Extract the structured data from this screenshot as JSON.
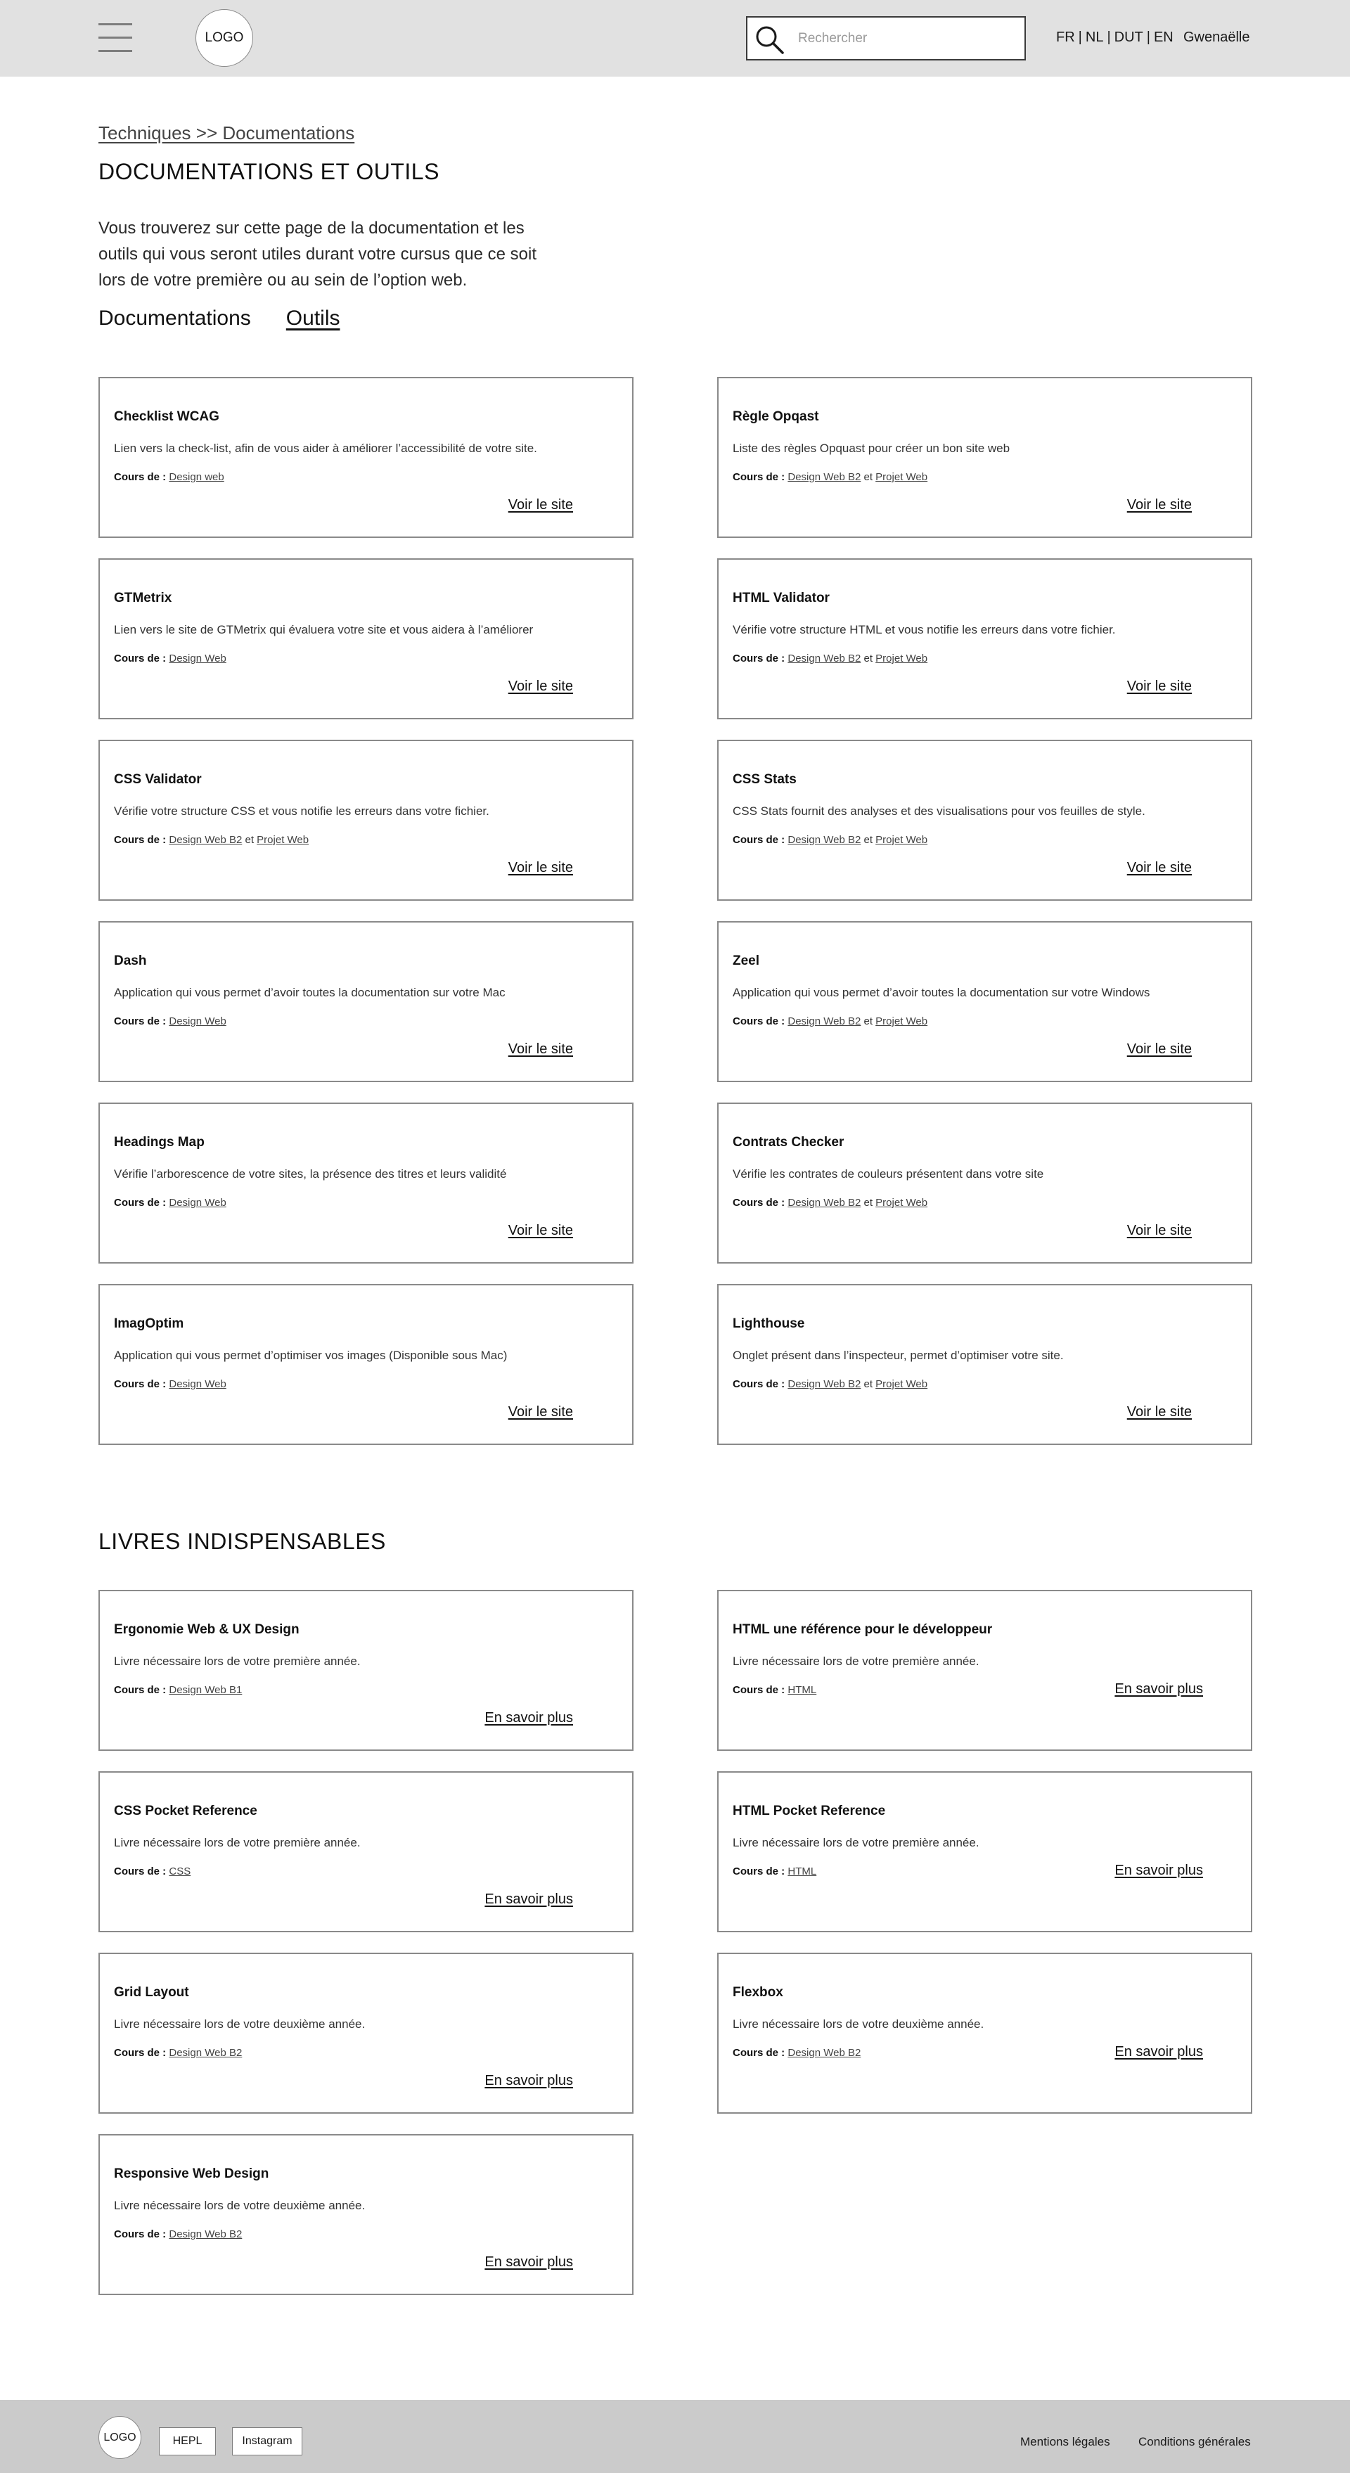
{
  "header": {
    "logo": "LOGO",
    "search_placeholder": "Rechercher",
    "languages": [
      "FR",
      "NL",
      "DUT",
      "EN"
    ],
    "user": "Gwenaëlle"
  },
  "breadcrumb": "Techniques >> Documentations",
  "page_title": "DOCUMENTATIONS ET OUTILS",
  "intro": "Vous trouverez sur cette page de la documentation et les outils qui vous seront utiles durant votre cursus que ce soit lors de votre première ou au sein de l’option web.",
  "tabs": {
    "documentations": "Documentations",
    "outils": "Outils"
  },
  "course_prefix": "Cours de :",
  "and_word": "et",
  "tools": [
    {
      "title": "Checklist WCAG",
      "desc": "Lien vers la check-list, afin de vous aider à améliorer l’accessibilité de votre site.",
      "courses": [
        "Design web"
      ],
      "action": "Voir le site"
    },
    {
      "title": "Règle Opqast",
      "desc": "Liste des règles Opquast pour créer un bon site web",
      "courses": [
        "Design Web B2",
        "Projet Web"
      ],
      "action": "Voir le site"
    },
    {
      "title": "GTMetrix",
      "desc": "Lien vers le site de GTMetrix qui évaluera votre site et vous aidera à l’améliorer",
      "courses": [
        "Design Web"
      ],
      "action": "Voir le site"
    },
    {
      "title": "HTML Validator",
      "desc": "Vérifie votre structure HTML et vous notifie les erreurs dans votre fichier.",
      "courses": [
        "Design Web B2",
        "Projet Web"
      ],
      "action": "Voir le site"
    },
    {
      "title": "CSS Validator",
      "desc": "Vérifie votre structure CSS et vous notifie les erreurs dans votre fichier.",
      "courses": [
        "Design Web B2",
        "Projet Web"
      ],
      "action": "Voir le site"
    },
    {
      "title": "CSS Stats",
      "desc": "CSS Stats fournit des analyses et des visualisations pour vos feuilles de style.",
      "courses": [
        "Design Web B2",
        "Projet Web"
      ],
      "action": "Voir le site"
    },
    {
      "title": "Dash",
      "desc": "Application qui vous permet d’avoir toutes la documentation sur votre Mac",
      "courses": [
        "Design Web"
      ],
      "action": "Voir le site"
    },
    {
      "title": "Zeel",
      "desc": "Application qui vous permet d’avoir toutes la documentation sur votre Windows",
      "courses": [
        "Design Web B2",
        "Projet Web"
      ],
      "action": "Voir le site"
    },
    {
      "title": "Headings Map",
      "desc": "Vérifie l’arborescence de votre sites, la présence des titres et leurs validité",
      "courses": [
        "Design Web"
      ],
      "action": "Voir le site"
    },
    {
      "title": "Contrats Checker",
      "desc": "Vérifie les contrates de couleurs présentent dans votre site",
      "courses": [
        "Design Web B2",
        "Projet Web"
      ],
      "action": "Voir le site"
    },
    {
      "title": "ImagOptim",
      "desc": "Application qui vous permet d’optimiser vos images (Disponible sous Mac)",
      "courses": [
        "Design Web"
      ],
      "action": "Voir le site"
    },
    {
      "title": "Lighthouse",
      "desc": "Onglet présent dans l’inspecteur, permet d’optimiser votre site.",
      "courses": [
        "Design Web B2",
        "Projet Web"
      ],
      "action": "Voir le site"
    }
  ],
  "books_title": "LIVRES INDISPENSABLES",
  "books": [
    {
      "title": "Ergonomie Web & UX Design",
      "desc": "Livre nécessaire lors de votre première année.",
      "courses": [
        "Design Web B1"
      ],
      "action": "En savoir plus"
    },
    {
      "title": "HTML une référence pour le développeur",
      "desc": "Livre nécessaire lors de votre première année.",
      "courses": [
        "HTML"
      ],
      "action": "En savoir plus"
    },
    {
      "title": "CSS Pocket Reference",
      "desc": "Livre nécessaire lors de votre première année.",
      "courses": [
        "CSS"
      ],
      "action": "En savoir plus"
    },
    {
      "title": "HTML Pocket Reference",
      "desc": "Livre nécessaire lors de votre première année.",
      "courses": [
        "HTML"
      ],
      "action": "En savoir plus"
    },
    {
      "title": "Grid Layout",
      "desc": "Livre nécessaire lors de votre deuxième année.",
      "courses": [
        "Design Web B2"
      ],
      "action": "En savoir plus"
    },
    {
      "title": "Flexbox",
      "desc": "Livre nécessaire lors de votre deuxième année.",
      "courses": [
        "Design Web B2"
      ],
      "action": "En savoir plus"
    },
    {
      "title": "Responsive Web Design",
      "desc": "Livre nécessaire lors de votre deuxième année.",
      "courses": [
        "Design Web B2"
      ],
      "action": "En savoir plus"
    }
  ],
  "footer": {
    "logo": "LOGO",
    "hepl": "HEPL",
    "instagram": "Instagram",
    "mentions": "Mentions légales",
    "conditions": "Conditions générales"
  },
  "colors": {
    "header_bg": "#e1e1e1",
    "footer_bg": "#cbcbcb",
    "card_border": "#8a8a8a"
  },
  "icons": [
    "menu-icon",
    "search-icon"
  ]
}
